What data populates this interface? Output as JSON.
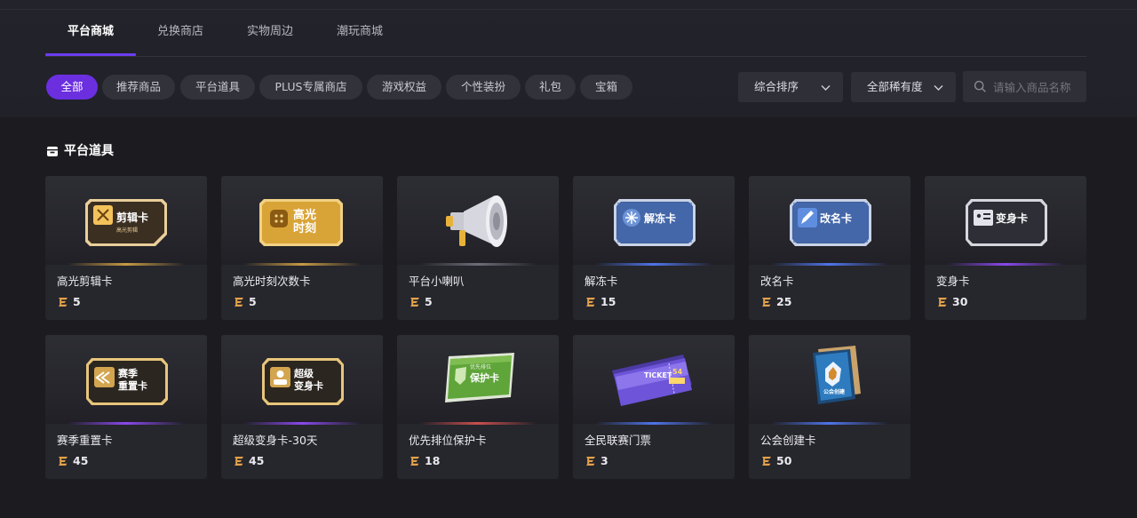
{
  "header_tabs": [
    {
      "label": "平台商城",
      "active": true
    },
    {
      "label": "兑换商店",
      "active": false
    },
    {
      "label": "实物周边",
      "active": false
    },
    {
      "label": "潮玩商城",
      "active": false
    }
  ],
  "filter_chips": [
    {
      "label": "全部",
      "active": true
    },
    {
      "label": "推荐商品",
      "active": false
    },
    {
      "label": "平台道具",
      "active": false
    },
    {
      "label": "PLUS专属商店",
      "active": false
    },
    {
      "label": "游戏权益",
      "active": false
    },
    {
      "label": "个性装扮",
      "active": false
    },
    {
      "label": "礼包",
      "active": false
    },
    {
      "label": "宝箱",
      "active": false
    }
  ],
  "sort_select": {
    "label": "综合排序"
  },
  "rarity_select": {
    "label": "全部稀有度"
  },
  "search": {
    "placeholder": "请输入商品名称",
    "value": ""
  },
  "section": {
    "title": "平台道具",
    "icon": "store-icon"
  },
  "colors": {
    "accent": "#6b2fe0",
    "tab_underline": "#6b3df0",
    "card_bg": "#26262d",
    "coin": "#e3a24a"
  },
  "products": [
    {
      "name": "高光剪辑卡",
      "price": "5",
      "art_text": [
        "剪辑卡",
        "高光剪辑"
      ],
      "style": "gold"
    },
    {
      "name": "高光时刻次数卡",
      "price": "5",
      "art_text": [
        "高光",
        "时刻"
      ],
      "style": "gold-full"
    },
    {
      "name": "平台小喇叭",
      "price": "5",
      "art_text": [],
      "style": "megaphone"
    },
    {
      "name": "解冻卡",
      "price": "15",
      "art_text": [
        "解冻卡"
      ],
      "style": "blue"
    },
    {
      "name": "改名卡",
      "price": "25",
      "art_text": [
        "改名卡"
      ],
      "style": "blue"
    },
    {
      "name": "变身卡",
      "price": "30",
      "art_text": [
        "变身卡"
      ],
      "style": "silver"
    },
    {
      "name": "赛季重置卡",
      "price": "45",
      "art_text": [
        "赛季",
        "重置卡"
      ],
      "style": "dark-gold"
    },
    {
      "name": "超级变身卡-30天",
      "price": "45",
      "art_text": [
        "超级",
        "变身卡"
      ],
      "style": "dark-gold"
    },
    {
      "name": "优先排位保护卡",
      "price": "18",
      "art_text": [
        "优先排位",
        "保护卡"
      ],
      "style": "green"
    },
    {
      "name": "全民联赛门票",
      "price": "3",
      "art_text": [
        "TICKET",
        "54"
      ],
      "style": "ticket"
    },
    {
      "name": "公会创建卡",
      "price": "50",
      "art_text": [
        "公会创建"
      ],
      "style": "guild"
    }
  ]
}
